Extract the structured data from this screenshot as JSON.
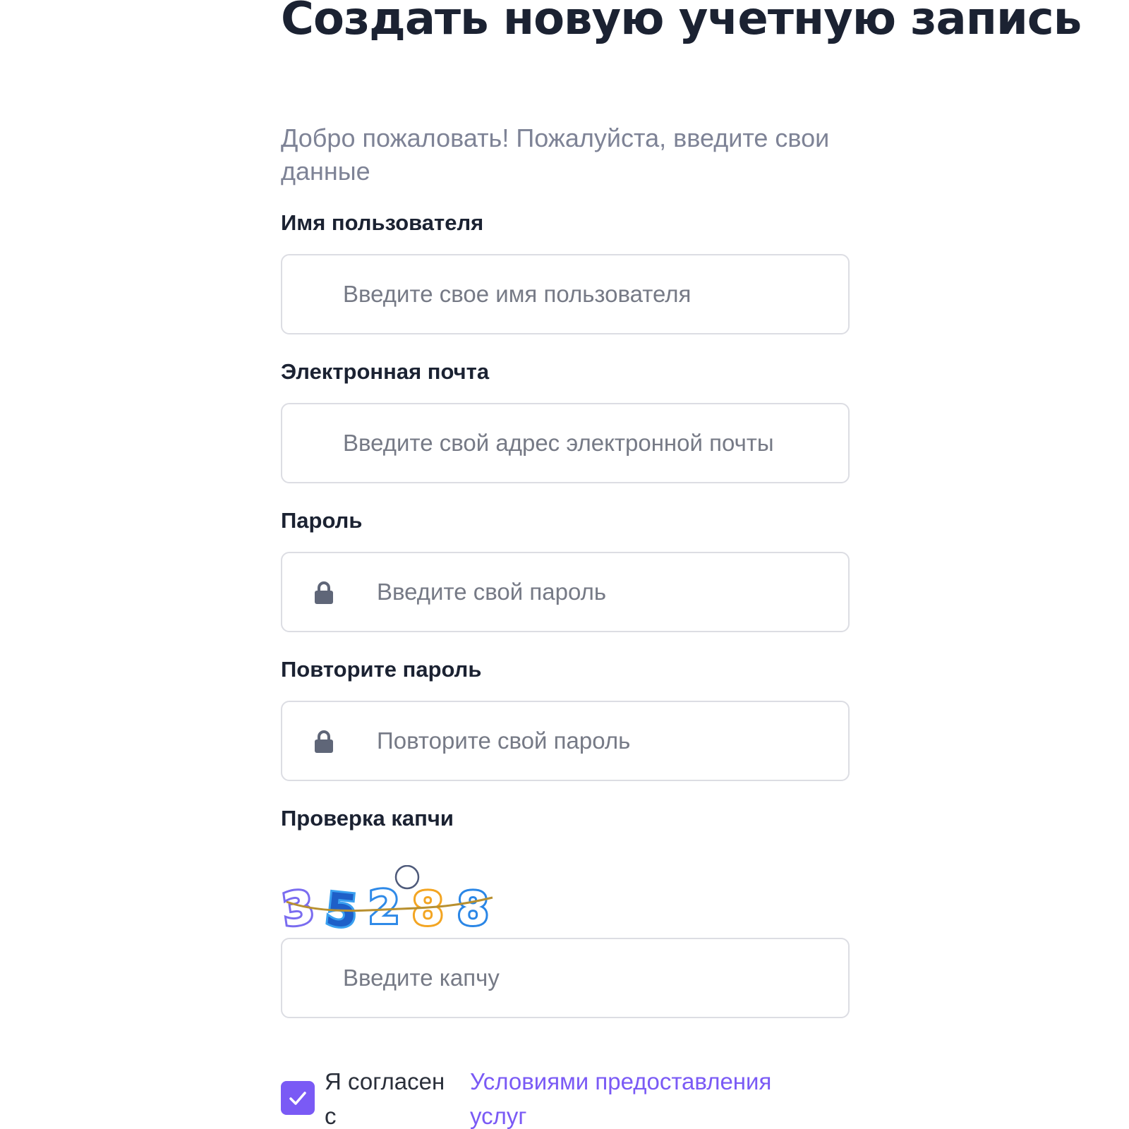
{
  "header": {
    "title": "Создать новую учетную запись",
    "subtitle": "Добро пожаловать! Пожалуйста, введите свои данные"
  },
  "fields": {
    "username": {
      "label": "Имя пользователя",
      "placeholder": "Введите свое имя пользователя",
      "value": ""
    },
    "email": {
      "label": "Электронная почта",
      "placeholder": "Введите свой адрес электронной почты",
      "value": ""
    },
    "password": {
      "label": "Пароль",
      "placeholder": "Введите свой пароль",
      "value": "",
      "icon": "lock-icon"
    },
    "password_repeat": {
      "label": "Повторите пароль",
      "placeholder": "Повторите свой пароль",
      "value": "",
      "icon": "lock-icon"
    },
    "captcha": {
      "label": "Проверка капчи",
      "image_text": "35288",
      "placeholder": "Введите капчу",
      "value": ""
    }
  },
  "agreement": {
    "checked": true,
    "text": "Я согласен с",
    "link_text": "Условиями предоставления услуг",
    "accent_color": "#7a5af5"
  },
  "colors": {
    "title": "#1b2232",
    "subtitle": "#7e8396",
    "border": "#dcdde3",
    "icon": "#5f6678"
  }
}
